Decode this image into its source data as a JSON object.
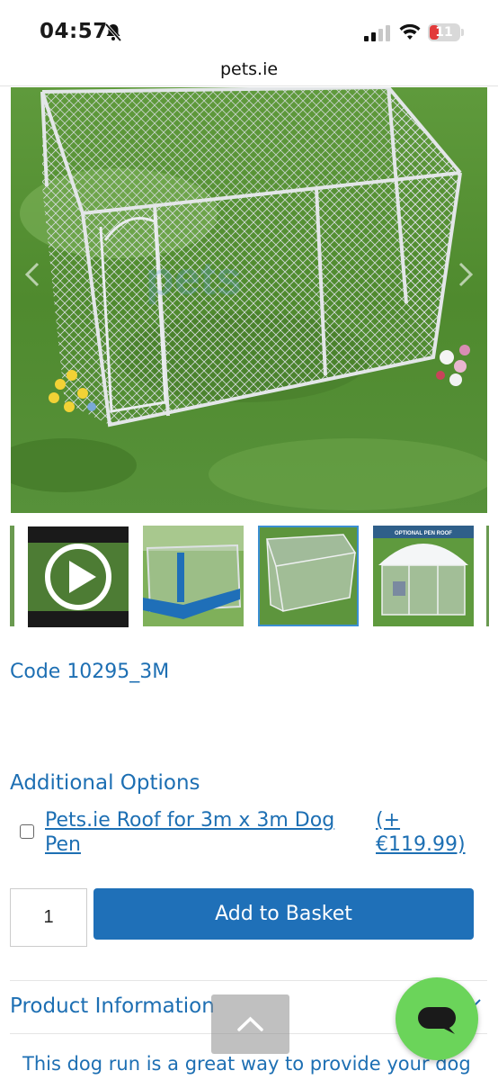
{
  "status_bar": {
    "time": "04:57",
    "icons": [
      "bell-slash-icon",
      "cellular-signal-icon",
      "wifi-icon"
    ],
    "battery_level": "11",
    "battery_color": "#e23a3a"
  },
  "browser": {
    "url": "pets.ie"
  },
  "gallery": {
    "main_image_alt": "dog-run-pen-photo",
    "thumbnails": [
      {
        "name": "video",
        "icon": "play-icon"
      },
      {
        "name": "pen-diagram"
      },
      {
        "name": "pen-on-grass"
      },
      {
        "name": "pen-with-roof"
      }
    ],
    "selected_index": 2
  },
  "product": {
    "code": "Code 10295_3M"
  },
  "options": {
    "title": "Additional Options",
    "items": [
      {
        "label": "Pets.ie Roof for 3m x 3m Dog Pen",
        "price": "(+ €119.99)",
        "checked": false
      }
    ]
  },
  "purchase": {
    "quantity": "1",
    "add_label": "Add to Basket"
  },
  "product_info": {
    "title": "Product Information",
    "description": "This dog run is a great way to provide your dog"
  },
  "colors": {
    "accent": "#1d6fb3",
    "button": "#1f70b8",
    "chat": "#6bd45a"
  }
}
